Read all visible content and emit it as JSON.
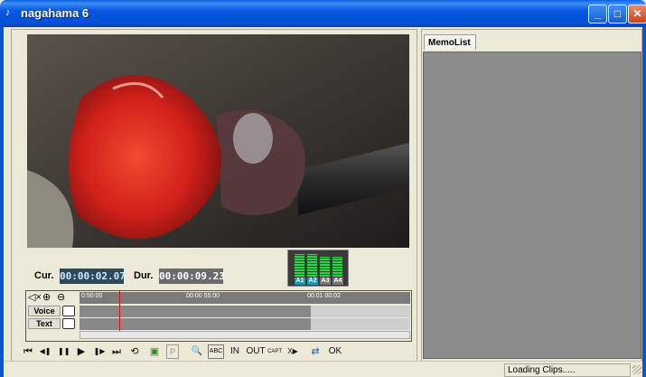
{
  "window": {
    "title": "nagahama 6",
    "icon": "app-icon",
    "controls": {
      "minimize": "_",
      "maximize": "□",
      "close": "✕"
    }
  },
  "player": {
    "cur_label": "Cur.",
    "cur_time": "00:00:02.07",
    "dur_label": "Dur.",
    "dur_time": "00:00:09.23"
  },
  "audio_meter": {
    "channels": [
      "A1",
      "A2",
      "A3",
      "A4"
    ],
    "levels": [
      0.88,
      0.88,
      0.8,
      0.8
    ]
  },
  "timeline": {
    "ruler_labels": [
      "0:50:00",
      "00:00 55:00",
      "00:01 00:02"
    ],
    "tracks": [
      "Voice",
      "Text"
    ],
    "played_fraction": 0.7
  },
  "transport": {
    "buttons": [
      {
        "name": "go-to-start-button",
        "glyph": "⏮"
      },
      {
        "name": "step-back-button",
        "glyph": "◀❚"
      },
      {
        "name": "pause-button",
        "glyph": "❚❚"
      },
      {
        "name": "play-button",
        "glyph": "▶"
      },
      {
        "name": "step-forward-button",
        "glyph": "❚▶"
      },
      {
        "name": "go-to-end-button",
        "glyph": "⏭"
      },
      {
        "name": "loop-button",
        "glyph": "⟲"
      },
      {
        "name": "snapshot-button",
        "glyph": "▣"
      },
      {
        "name": "p-button",
        "glyph": "P"
      },
      {
        "name": "search-button",
        "glyph": "🔍"
      },
      {
        "name": "abc-button",
        "glyph": "ABC"
      },
      {
        "name": "in-button",
        "glyph": "IN"
      },
      {
        "name": "out-button",
        "glyph": "OUT"
      },
      {
        "name": "capture-button",
        "glyph": "CAPT"
      },
      {
        "name": "exec-button",
        "glyph": "X▶"
      },
      {
        "name": "link-button",
        "glyph": "⇄"
      },
      {
        "name": "ok-button",
        "glyph": "OK"
      }
    ]
  },
  "memolist": {
    "tab_label": "MemoList"
  },
  "status": {
    "text": "Loading Clips....."
  }
}
